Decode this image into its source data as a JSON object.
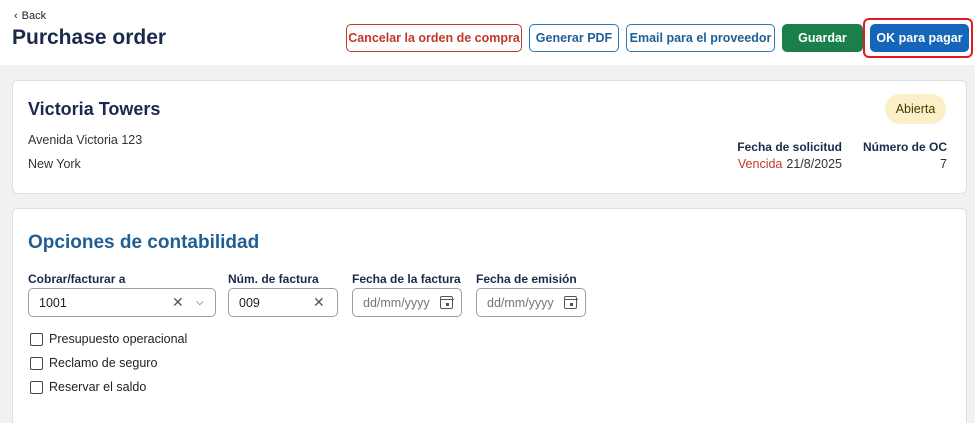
{
  "header": {
    "back_label": "Back",
    "title": "Purchase order"
  },
  "actions": {
    "cancel": "Cancelar la orden de compra",
    "pdf": "Generar PDF",
    "email": "Email para el proveedor",
    "save": "Guardar",
    "ok": "OK para pagar"
  },
  "property": {
    "name": "Victoria Towers",
    "address_line1": "Avenida Victoria 123",
    "address_line2": "New York",
    "status": "Abierta",
    "request_date_label": "Fecha de solicitud",
    "overdue_label": "Vencida",
    "request_date": "21/8/2025",
    "po_number_label": "Número de OC",
    "po_number": "7"
  },
  "accounting": {
    "title": "Opciones de contabilidad",
    "bill_to_label": "Cobrar/facturar a",
    "bill_to_value": "1001",
    "invoice_number_label": "Núm. de factura",
    "invoice_number_value": "009",
    "invoice_date_label": "Fecha de la factura",
    "invoice_date_placeholder": "dd/mm/yyyy",
    "issue_date_label": "Fecha de emisión",
    "issue_date_placeholder": "dd/mm/yyyy",
    "checkboxes": [
      {
        "label": "Presupuesto operacional",
        "checked": false
      },
      {
        "label": "Reclamo de seguro",
        "checked": false
      },
      {
        "label": "Reservar el saldo",
        "checked": false
      }
    ]
  },
  "colors": {
    "primary": "#1565b8",
    "save": "#1a7f4a",
    "danger": "#c0392b",
    "highlight": "#e01b24",
    "status_badge_bg": "#fbefc8"
  }
}
